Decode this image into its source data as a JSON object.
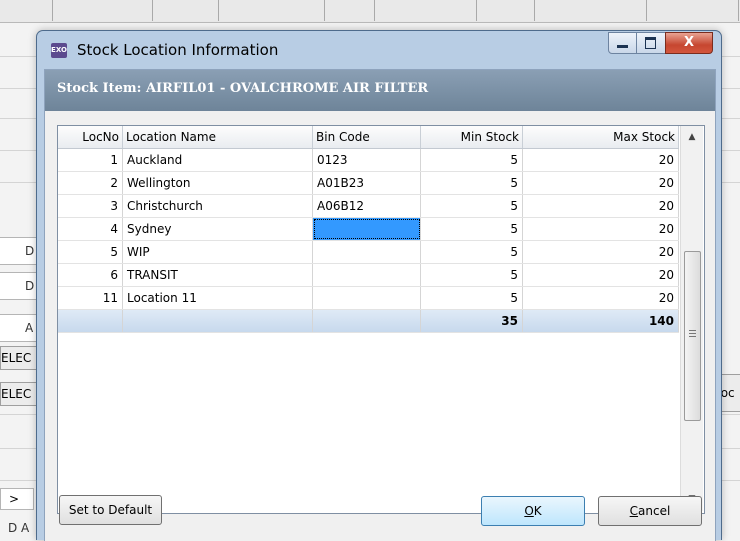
{
  "dialog": {
    "title": "Stock Location Information",
    "logo_text": "EXO",
    "close_glyph": "X",
    "stock_item_label": "Stock Item:  AIRFIL01 - OVALCHROME AIR FILTER"
  },
  "grid": {
    "columns": [
      "LocNo",
      "Location Name",
      "Bin Code",
      "Min Stock",
      "Max Stock"
    ],
    "rows": [
      {
        "locno": "1",
        "name": "Auckland",
        "bin": "0123",
        "min": "5",
        "max": "20"
      },
      {
        "locno": "2",
        "name": "Wellington",
        "bin": "A01B23",
        "min": "5",
        "max": "20"
      },
      {
        "locno": "3",
        "name": "Christchurch",
        "bin": "A06B12",
        "min": "5",
        "max": "20"
      },
      {
        "locno": "4",
        "name": "Sydney",
        "bin": "",
        "min": "5",
        "max": "20"
      },
      {
        "locno": "5",
        "name": "WIP",
        "bin": "",
        "min": "5",
        "max": "20"
      },
      {
        "locno": "6",
        "name": "TRANSIT",
        "bin": "",
        "min": "5",
        "max": "20"
      },
      {
        "locno": "11",
        "name": "Location 11",
        "bin": "",
        "min": "5",
        "max": "20"
      }
    ],
    "totals": {
      "min": "35",
      "max": "140"
    },
    "selected_row_index": 3,
    "selected_column": "Bin Code",
    "scroll_up_glyph": "▲",
    "scroll_down_glyph": "▼"
  },
  "buttons": {
    "set_default": "Set to Default",
    "ok": "OK",
    "cancel": "Cancel"
  },
  "background": {
    "left_labels": [
      "D",
      "D",
      "A"
    ],
    "button_labels": [
      "ELEC",
      "ELEC"
    ],
    "right_button": "toc",
    "arrow": ">",
    "bottom_text": "D A"
  },
  "colors": {
    "header_band": "#7b90a6",
    "selection": "#3399ff",
    "total_row": "#cfdff1",
    "close_button": "#c64630"
  }
}
